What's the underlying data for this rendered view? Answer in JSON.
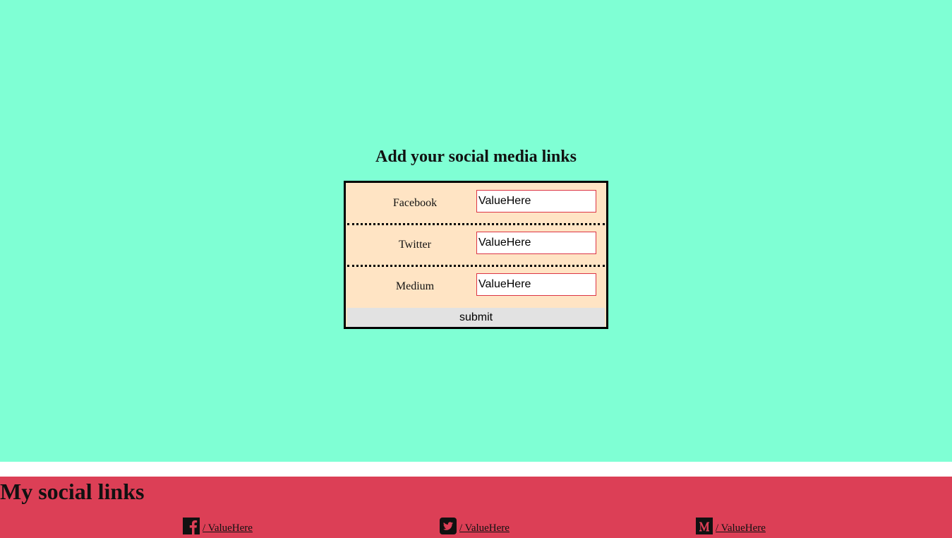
{
  "form": {
    "title": "Add your social media links",
    "rows": [
      {
        "label": "Facebook",
        "value": "ValueHere"
      },
      {
        "label": "Twitter",
        "value": "ValueHere"
      },
      {
        "label": "Medium",
        "value": "ValueHere"
      }
    ],
    "submit_label": "submit"
  },
  "links": {
    "title": "My social links",
    "items": [
      {
        "icon": "facebook-icon",
        "text": "/ ValueHere"
      },
      {
        "icon": "twitter-icon",
        "text": "/ ValueHere"
      },
      {
        "icon": "medium-icon",
        "text": "/ ValueHere"
      }
    ]
  },
  "colors": {
    "top_background": "#7fffd4",
    "form_background": "#ffe4c4",
    "input_border": "#dc3545",
    "bottom_background": "#dc3f56"
  }
}
